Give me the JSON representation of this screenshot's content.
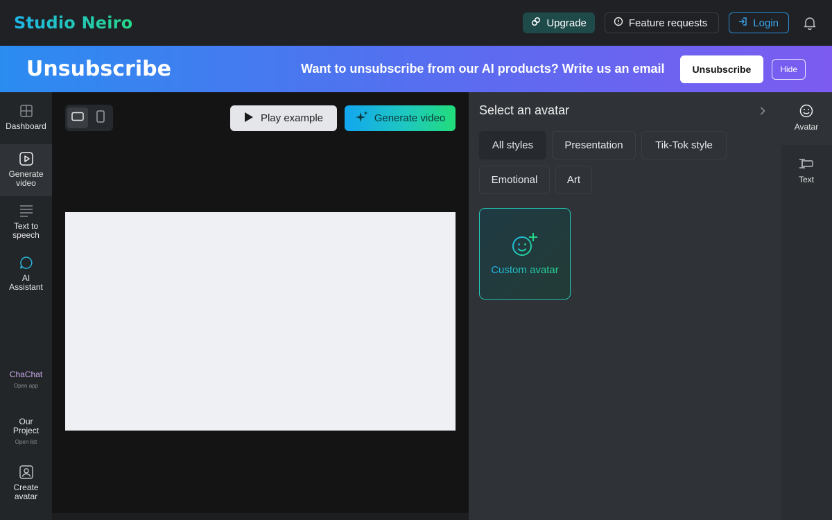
{
  "header": {
    "logo": "Studio Neiro",
    "upgrade_label": "Upgrade",
    "feature_label": "Feature requests",
    "login_label": "Login"
  },
  "banner": {
    "title": "Unsubscribe",
    "message": "Want to unsubscribe from our AI products? Write us an email",
    "unsubscribe_label": "Unsubscribe",
    "hide_label": "Hide"
  },
  "sidebar": {
    "items": [
      {
        "label": "Dashboard",
        "icon": "grid-icon"
      },
      {
        "label": "Generate video",
        "icon": "play-square-icon"
      },
      {
        "label": "Text to speech",
        "icon": "text-lines-icon"
      },
      {
        "label": "AI Assistant",
        "icon": "chat-bubble-icon"
      },
      {
        "label": "ChaChat",
        "sub": "Open app"
      },
      {
        "label": "Our Project",
        "sub": "Open list"
      },
      {
        "label": "Create avatar",
        "icon": "user-square-icon"
      }
    ]
  },
  "editor": {
    "play_example_label": "Play example",
    "generate_label": "Generate video"
  },
  "avatar_panel": {
    "title": "Select an avatar",
    "styles": [
      {
        "label": "All styles",
        "selected": true
      },
      {
        "label": "Presentation",
        "selected": false
      },
      {
        "label": "Tik-Tok style",
        "selected": false
      },
      {
        "label": "Emotional",
        "selected": false
      },
      {
        "label": "Art",
        "selected": false
      }
    ],
    "custom_label": "Custom avatar"
  },
  "rightrail": {
    "items": [
      {
        "label": "Avatar",
        "icon": "smiley-icon"
      },
      {
        "label": "Text",
        "icon": "text-cursor-icon"
      }
    ]
  },
  "colors": {
    "accent_start": "#1fb5e8",
    "accent_end": "#27d68a",
    "login_blue": "#3aa6f0",
    "banner_start": "#2b8cf0",
    "banner_end": "#7c5cf0"
  }
}
